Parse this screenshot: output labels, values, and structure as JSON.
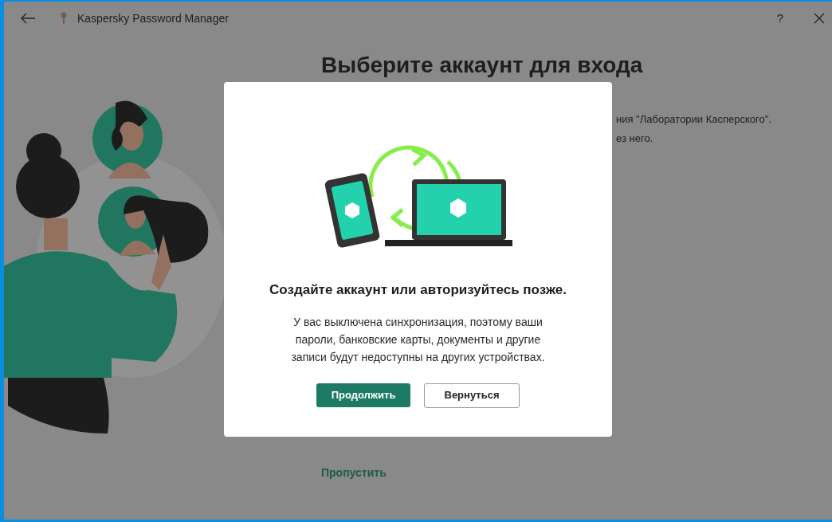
{
  "window": {
    "title": "Kaspersky Password Manager",
    "help": "?"
  },
  "background": {
    "heading": "Выберите аккаунт для входа",
    "description_lines": [
      "ния \"Лаборатории Касперского\".",
      "ез него."
    ],
    "skip_link": "Пропустить"
  },
  "dialog": {
    "title": "Создайте аккаунт или авторизуйтесь позже.",
    "message": "У вас выключена синхронизация, поэтому ваши пароли, банковские карты, документы и другие записи будут недоступны на других устройствах.",
    "buttons": [
      {
        "label": "Продолжить",
        "kind": "primary"
      },
      {
        "label": "Вернуться",
        "kind": "secondary"
      }
    ]
  }
}
